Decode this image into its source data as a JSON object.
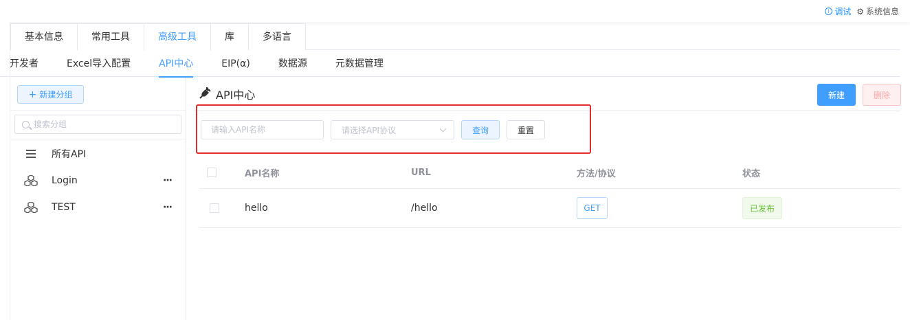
{
  "topbar": {
    "debug_label": "调试",
    "sysinfo_label": "系统信息"
  },
  "main_tabs": [
    {
      "label": "基本信息"
    },
    {
      "label": "常用工具"
    },
    {
      "label": "高级工具",
      "active": true
    },
    {
      "label": "库"
    },
    {
      "label": "多语言"
    }
  ],
  "sub_tabs": [
    {
      "label": "开发者"
    },
    {
      "label": "Excel导入配置"
    },
    {
      "label": "API中心",
      "active": true
    },
    {
      "label": "EIP(α)"
    },
    {
      "label": "数据源"
    },
    {
      "label": "元数据管理"
    }
  ],
  "left_panel": {
    "new_group_label": "新建分组",
    "search_placeholder": "搜索分组",
    "groups": [
      {
        "label": "所有API",
        "icon": "list-icon"
      },
      {
        "label": "Login",
        "icon": "cubes-icon",
        "more": "···"
      },
      {
        "label": "TEST",
        "icon": "cubes-icon",
        "more": "···"
      }
    ]
  },
  "content": {
    "title": "API中心",
    "new_label": "新建",
    "delete_label": "删除",
    "filter": {
      "name_placeholder": "请输入API名称",
      "protocol_placeholder": "请选择API协议",
      "query_label": "查询",
      "reset_label": "重置"
    },
    "table": {
      "columns": [
        "API名称",
        "URL",
        "方法/协议",
        "状态"
      ],
      "rows": [
        {
          "name": "hello",
          "url": "/hello",
          "method": "GET",
          "status": "已发布"
        }
      ]
    }
  },
  "colors": {
    "accent": "#409eff",
    "highlight_box": "#e12c2c",
    "status_published": "#67c23a"
  }
}
